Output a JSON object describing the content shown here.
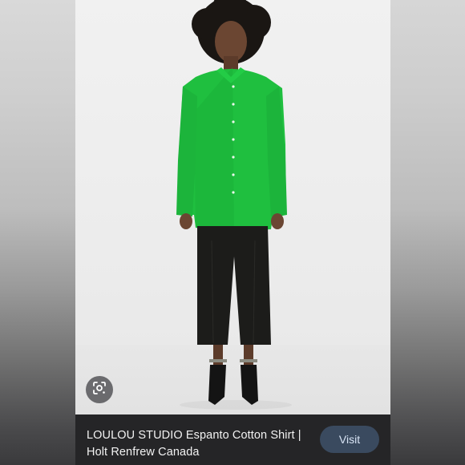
{
  "image": {
    "icon": "person-photo",
    "colors": {
      "shirt": "#1fbf3f",
      "pants": "#1c1c1a",
      "background": "#eeeeee"
    }
  },
  "lens": {
    "icon": "lens-search-icon"
  },
  "caption": {
    "title": "LOULOU STUDIO Espanto Cotton Shirt | Holt Renfrew Canada",
    "visit_label": "Visit"
  }
}
